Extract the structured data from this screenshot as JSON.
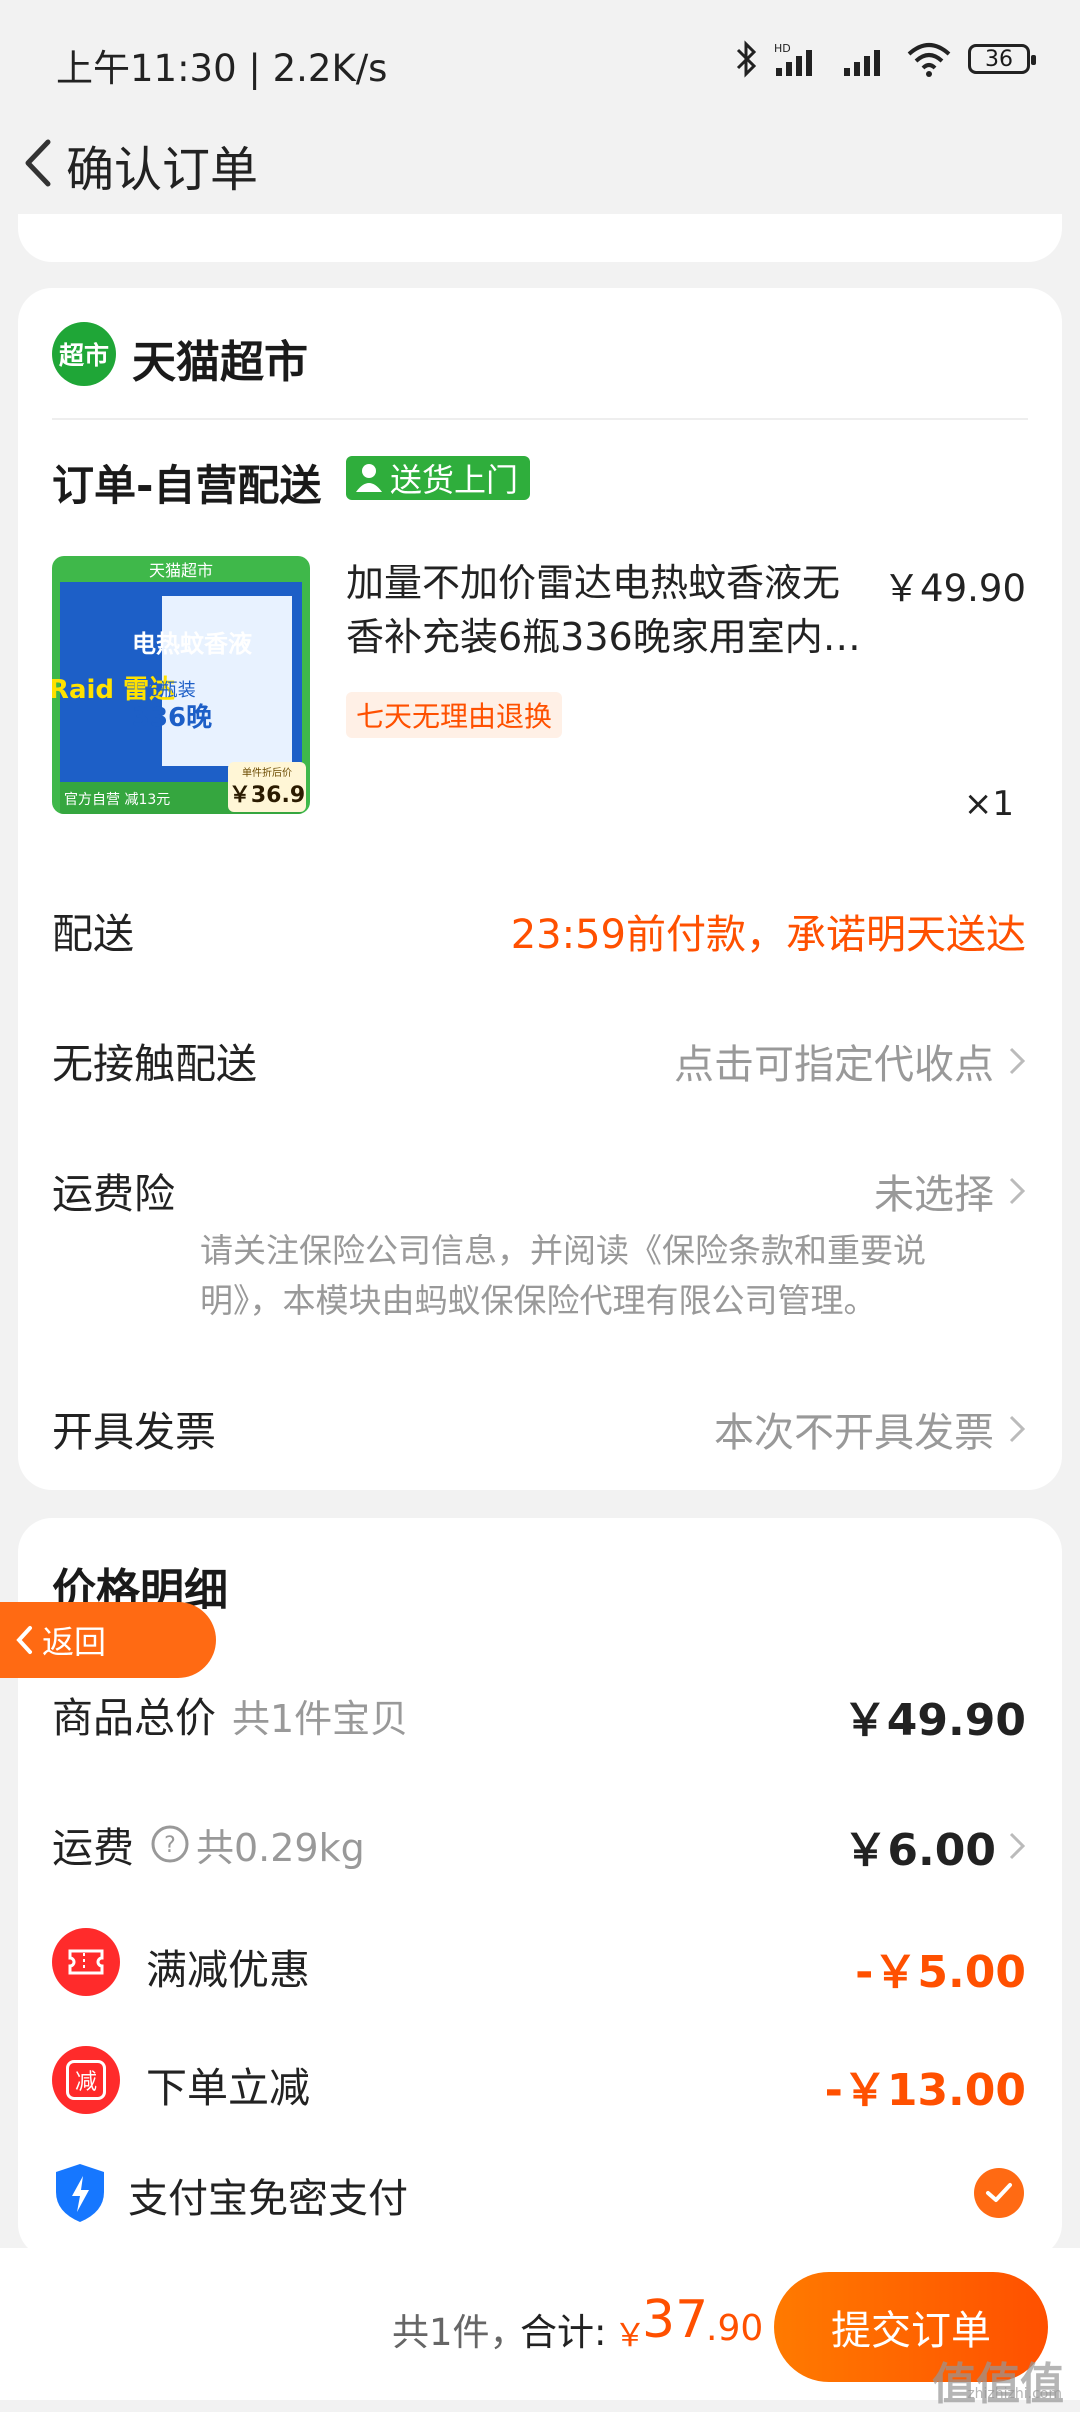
{
  "status": {
    "time": "上午11:30 | 2.2K/s",
    "battery": "36",
    "icons": [
      "bluetooth-icon",
      "hd-signal-icon",
      "signal-icon",
      "wifi-icon",
      "battery-icon"
    ]
  },
  "header": {
    "title": "确认订单"
  },
  "store": {
    "logo_text": "超市",
    "name": "天猫超市"
  },
  "order": {
    "type": "订单-自营配送",
    "delivery_tag": "送货上门",
    "product": {
      "title": "加量不加价雷达电热蚊香液无香补充装6瓶336晚家用室内…",
      "price": "￥49.90",
      "return_tag": "七天无理由退换",
      "quantity": "×1",
      "image": {
        "banner": "天猫超市",
        "brand": "Raid 雷达",
        "name": "电热蚊香液",
        "count": "336晚",
        "bottles": "6瓶装",
        "footer": "官方自营 减13元",
        "unit_price_label": "单件折后价",
        "unit_price": "￥36.9"
      }
    },
    "rows": {
      "delivery_label": "配送",
      "delivery_value": "23:59前付款，承诺明天送达",
      "contactless_label": "无接触配送",
      "contactless_value": "点击可指定代收点",
      "insurance_label": "运费险",
      "insurance_value": "未选择",
      "insurance_note": "请关注保险公司信息，并阅读《保险条款和重要说明》，本模块由蚂蚁保保险代理有限公司管理。",
      "invoice_label": "开具发票",
      "invoice_value": "本次不开具发票"
    }
  },
  "price_detail": {
    "title": "价格明细",
    "back_label": "返回",
    "goods_label": "商品总价",
    "goods_sub": "共1件宝贝",
    "goods_value": "￥49.90",
    "shipping_label": "运费",
    "shipping_sub": "共0.29kg",
    "shipping_value": "￥6.00",
    "discount1_label": "满减优惠",
    "discount1_value": "-￥5.00",
    "discount2_label": "下单立减",
    "discount2_icon_text": "减",
    "discount2_value": "-￥13.00",
    "alipay_label": "支付宝免密支付"
  },
  "bottom": {
    "count": "共1件，",
    "total_label": "合计:",
    "currency": "￥",
    "total_int": "37",
    "total_dec": ".90",
    "submit": "提交订单"
  },
  "watermark": {
    "text": "值值值",
    "sub": "zhizhizhi.com"
  },
  "colors": {
    "accent": "#ff5000",
    "green": "#2fae3c",
    "card": "#ffffff",
    "bg": "#f2f2f2"
  }
}
